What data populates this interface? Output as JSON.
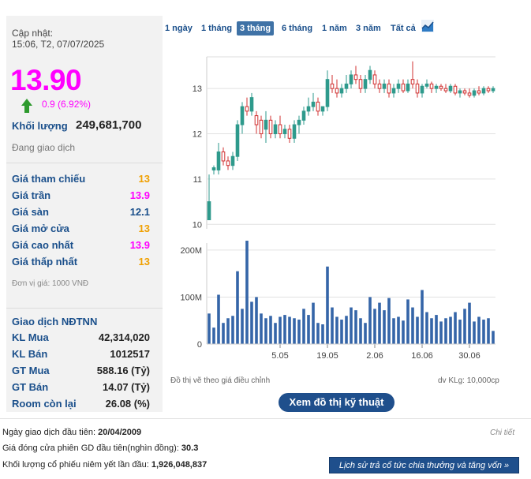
{
  "summary": {
    "updated_label": "Cập nhật:",
    "updated_time": "15:06, T2, 07/07/2025",
    "price": "13.90",
    "change": "0.9 (6.92%)",
    "volume_label": "Khối lượng",
    "volume_value": "249,681,700",
    "status": "Đang giao dịch",
    "unit_note": "Đơn vị giá: 1000 VNĐ"
  },
  "price_rows": [
    {
      "label": "Giá tham chiếu",
      "value": "13"
    },
    {
      "label": "Giá trần",
      "value": "13.9"
    },
    {
      "label": "Giá sàn",
      "value": "12.1"
    },
    {
      "label": "Giá mở cửa",
      "value": "13"
    },
    {
      "label": "Giá cao nhất",
      "value": "13.9"
    },
    {
      "label": "Giá thấp nhất",
      "value": "13"
    }
  ],
  "foreign": {
    "title": "Giao dịch NĐTNN",
    "rows": [
      {
        "label": "KL Mua",
        "value": "42,314,020"
      },
      {
        "label": "KL Bán",
        "value": "1012517"
      },
      {
        "label": "GT Mua",
        "value": "588.16 (Tỷ)"
      },
      {
        "label": "GT Bán",
        "value": "14.07 (Tỷ)"
      },
      {
        "label": "Room còn lại",
        "value": "26.08 (%)"
      }
    ]
  },
  "tabs": [
    "1 ngày",
    "1 tháng",
    "3 tháng",
    "6 tháng",
    "1 năm",
    "3 năm",
    "Tất cả"
  ],
  "active_tab": "3 tháng",
  "colors": {
    "price_magenta": "#ff00ff",
    "label_blue": "#1a4f8b",
    "ceiling": "#ff00ff",
    "floor": "#00a0c8",
    "reference": "#f0a000",
    "up_candle": "#2e9a8c",
    "down_candle": "#d03030",
    "volume_bar": "#3565a8",
    "button": "#1f4f8c"
  },
  "chart_notes": {
    "left": "Đồ thị vẽ theo giá điều chỉnh",
    "right": "dv KLg: 10,000cp"
  },
  "buttons": {
    "technical_chart": "Xem đồ thị kỹ thuật",
    "history": "Lịch sử trả cổ tức chia thưởng và tăng vốn »"
  },
  "footer": {
    "first_trade_label": "Ngày giao dịch đầu tiên:",
    "first_trade_value": "20/04/2009",
    "first_close_label": "Giá đóng cửa phiên GD đầu tiên(nghìn đồng):",
    "first_close_value": "30.3",
    "listed_label": "Khối lượng cổ phiếu niêm yết lần đầu:",
    "listed_value": "1,926,048,837",
    "detail_link": "Chi tiết"
  },
  "chart_data": {
    "type": "candlestick",
    "price_axis": {
      "ticks": [
        10,
        11,
        12,
        13
      ],
      "range": [
        9.9,
        13.7
      ]
    },
    "volume_axis": {
      "ticks": [
        "0",
        "100M",
        "200M"
      ],
      "tick_values": [
        0,
        100,
        200
      ],
      "range": [
        0,
        215
      ],
      "unit": "M"
    },
    "x_ticks": [
      {
        "label": "5.05",
        "index": 15
      },
      {
        "label": "19.05",
        "index": 25
      },
      {
        "label": "2.06",
        "index": 35
      },
      {
        "label": "16.06",
        "index": 45
      },
      {
        "label": "30.06",
        "index": 55
      }
    ],
    "candles": [
      {
        "o": 10.1,
        "h": 11.1,
        "l": 10.1,
        "c": 10.5
      },
      {
        "o": 11.2,
        "h": 11.3,
        "l": 11.1,
        "c": 11.25
      },
      {
        "o": 11.2,
        "h": 11.8,
        "l": 11.1,
        "c": 11.6
      },
      {
        "o": 11.6,
        "h": 11.7,
        "l": 11.3,
        "c": 11.4
      },
      {
        "o": 11.4,
        "h": 11.5,
        "l": 11.2,
        "c": 11.3
      },
      {
        "o": 11.3,
        "h": 11.6,
        "l": 11.2,
        "c": 11.5
      },
      {
        "o": 11.5,
        "h": 12.3,
        "l": 11.4,
        "c": 12.2
      },
      {
        "o": 12.2,
        "h": 12.7,
        "l": 12.0,
        "c": 12.6
      },
      {
        "o": 12.6,
        "h": 12.8,
        "l": 12.4,
        "c": 12.5
      },
      {
        "o": 12.5,
        "h": 12.9,
        "l": 12.4,
        "c": 12.8
      },
      {
        "o": 12.4,
        "h": 12.5,
        "l": 12.0,
        "c": 12.2
      },
      {
        "o": 12.3,
        "h": 12.4,
        "l": 11.9,
        "c": 12.0
      },
      {
        "o": 12.1,
        "h": 12.5,
        "l": 11.8,
        "c": 12.3
      },
      {
        "o": 12.3,
        "h": 12.4,
        "l": 11.9,
        "c": 12.0
      },
      {
        "o": 12.0,
        "h": 12.3,
        "l": 11.9,
        "c": 12.2
      },
      {
        "o": 12.2,
        "h": 12.4,
        "l": 11.9,
        "c": 12.0
      },
      {
        "o": 12.0,
        "h": 12.2,
        "l": 11.9,
        "c": 12.1
      },
      {
        "o": 12.1,
        "h": 12.2,
        "l": 11.8,
        "c": 11.9
      },
      {
        "o": 11.9,
        "h": 12.3,
        "l": 11.8,
        "c": 12.2
      },
      {
        "o": 12.2,
        "h": 12.4,
        "l": 12.0,
        "c": 12.3
      },
      {
        "o": 12.3,
        "h": 12.6,
        "l": 12.2,
        "c": 12.5
      },
      {
        "o": 12.5,
        "h": 12.8,
        "l": 12.4,
        "c": 12.6
      },
      {
        "o": 12.6,
        "h": 12.9,
        "l": 12.5,
        "c": 12.7
      },
      {
        "o": 12.7,
        "h": 12.8,
        "l": 12.4,
        "c": 12.5
      },
      {
        "o": 12.5,
        "h": 12.6,
        "l": 12.4,
        "c": 12.6
      },
      {
        "o": 12.6,
        "h": 13.4,
        "l": 12.5,
        "c": 13.2
      },
      {
        "o": 13.1,
        "h": 13.3,
        "l": 12.9,
        "c": 13.0
      },
      {
        "o": 13.0,
        "h": 13.2,
        "l": 12.8,
        "c": 12.9
      },
      {
        "o": 12.9,
        "h": 13.1,
        "l": 12.8,
        "c": 13.0
      },
      {
        "o": 13.0,
        "h": 13.3,
        "l": 12.9,
        "c": 13.1
      },
      {
        "o": 13.1,
        "h": 13.4,
        "l": 13.0,
        "c": 13.3
      },
      {
        "o": 13.3,
        "h": 13.5,
        "l": 13.1,
        "c": 13.2
      },
      {
        "o": 13.2,
        "h": 13.3,
        "l": 12.9,
        "c": 13.0
      },
      {
        "o": 13.0,
        "h": 13.3,
        "l": 12.9,
        "c": 13.2
      },
      {
        "o": 13.2,
        "h": 13.5,
        "l": 13.1,
        "c": 13.4
      },
      {
        "o": 13.3,
        "h": 13.4,
        "l": 13.0,
        "c": 13.1
      },
      {
        "o": 13.1,
        "h": 13.2,
        "l": 12.9,
        "c": 13.0
      },
      {
        "o": 13.0,
        "h": 13.2,
        "l": 12.9,
        "c": 13.1
      },
      {
        "o": 13.1,
        "h": 13.2,
        "l": 12.8,
        "c": 12.9
      },
      {
        "o": 12.9,
        "h": 13.1,
        "l": 12.8,
        "c": 13.0
      },
      {
        "o": 13.0,
        "h": 13.2,
        "l": 12.9,
        "c": 13.1
      },
      {
        "o": 13.1,
        "h": 13.2,
        "l": 12.9,
        "c": 12.95
      },
      {
        "o": 12.95,
        "h": 13.2,
        "l": 12.9,
        "c": 13.1
      },
      {
        "o": 13.2,
        "h": 13.6,
        "l": 13.0,
        "c": 13.1
      },
      {
        "o": 13.1,
        "h": 13.2,
        "l": 12.8,
        "c": 12.9
      },
      {
        "o": 12.9,
        "h": 13.1,
        "l": 12.8,
        "c": 13.05
      },
      {
        "o": 13.05,
        "h": 13.2,
        "l": 13.0,
        "c": 13.1
      },
      {
        "o": 13.1,
        "h": 13.15,
        "l": 12.9,
        "c": 13.0
      },
      {
        "o": 13.0,
        "h": 13.1,
        "l": 12.9,
        "c": 13.05
      },
      {
        "o": 13.05,
        "h": 13.1,
        "l": 12.95,
        "c": 13.0
      },
      {
        "o": 13.0,
        "h": 13.1,
        "l": 12.9,
        "c": 12.95
      },
      {
        "o": 12.95,
        "h": 13.1,
        "l": 12.9,
        "c": 13.05
      },
      {
        "o": 13.05,
        "h": 13.1,
        "l": 12.85,
        "c": 12.9
      },
      {
        "o": 12.9,
        "h": 13.0,
        "l": 12.8,
        "c": 12.95
      },
      {
        "o": 12.95,
        "h": 13.0,
        "l": 12.85,
        "c": 12.9
      },
      {
        "o": 12.9,
        "h": 13.0,
        "l": 12.8,
        "c": 12.85
      },
      {
        "o": 12.85,
        "h": 13.0,
        "l": 12.8,
        "c": 12.95
      },
      {
        "o": 12.95,
        "h": 13.05,
        "l": 12.85,
        "c": 12.9
      },
      {
        "o": 12.9,
        "h": 13.05,
        "l": 12.85,
        "c": 13.0
      },
      {
        "o": 13.0,
        "h": 13.05,
        "l": 12.9,
        "c": 12.95
      },
      {
        "o": 12.95,
        "h": 13.05,
        "l": 12.9,
        "c": 13.0
      }
    ],
    "volumes": [
      65,
      35,
      105,
      45,
      55,
      60,
      155,
      75,
      220,
      90,
      100,
      65,
      55,
      60,
      45,
      58,
      62,
      58,
      55,
      52,
      75,
      62,
      88,
      45,
      42,
      165,
      78,
      58,
      52,
      60,
      78,
      72,
      55,
      45,
      100,
      75,
      88,
      72,
      98,
      55,
      58,
      50,
      95,
      78,
      58,
      115,
      68,
      55,
      62,
      48,
      55,
      58,
      68,
      52,
      75,
      88,
      48,
      58,
      52,
      55,
      28
    ]
  }
}
